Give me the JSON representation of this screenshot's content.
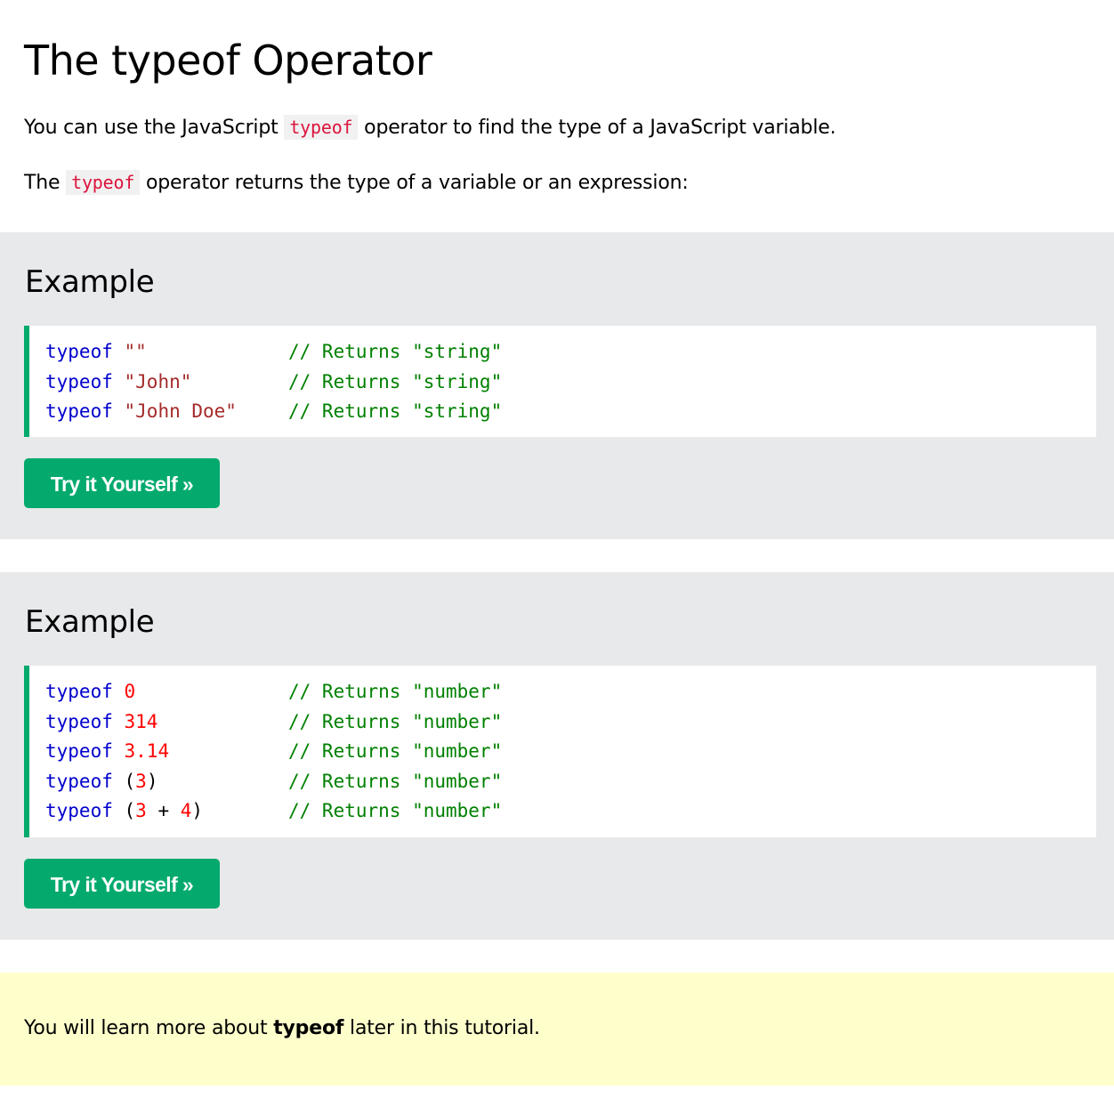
{
  "page_title": "The typeof Operator",
  "intro": {
    "p1_before": "You can use the JavaScript ",
    "p1_code": "typeof",
    "p1_after": " operator to find the type of a JavaScript variable.",
    "p2_before": "The ",
    "p2_code": "typeof",
    "p2_after": " operator returns the type of a variable or an expression:"
  },
  "examples": [
    {
      "heading": "Example",
      "lines": [
        {
          "kw": "typeof",
          "p1": " ",
          "arg": "\"\"",
          "comment": "// Returns \"string\""
        },
        {
          "kw": "typeof",
          "p1": " ",
          "arg": "\"John\"",
          "comment": "// Returns \"string\""
        },
        {
          "kw": "typeof",
          "p1": " ",
          "arg": "\"John Doe\"",
          "comment": "// Returns \"string\""
        }
      ],
      "button_label": "Try it Yourself »"
    },
    {
      "heading": "Example",
      "lines": [
        {
          "kw": "typeof",
          "p1": " ",
          "arg": "0",
          "comment": "// Returns \"number\""
        },
        {
          "kw": "typeof",
          "p1": " ",
          "arg": "314",
          "comment": "// Returns \"number\""
        },
        {
          "kw": "typeof",
          "p1": " ",
          "arg": "3.14",
          "comment": "// Returns \"number\""
        },
        {
          "kw": "typeof",
          "p1": " (",
          "arg": "3",
          "p2": ")",
          "comment": "// Returns \"number\""
        },
        {
          "kw": "typeof",
          "p1": " (",
          "arg": "3",
          "p2": " + ",
          "arg2": "4",
          "p3": ")",
          "comment": "// Returns \"number\""
        }
      ],
      "button_label": "Try it Yourself »"
    }
  ],
  "note": {
    "before": "You will learn more about ",
    "bold": "typeof",
    "after": " later in this tutorial."
  },
  "colors": {
    "accent_green": "#04aa6d",
    "example_bg": "#e7e9eb",
    "note_bg": "#ffffcc",
    "keyword": "#0000cd",
    "string": "#a52a2a",
    "number": "#ff0000",
    "comment": "#008000",
    "inline_code": "#dc143c"
  }
}
